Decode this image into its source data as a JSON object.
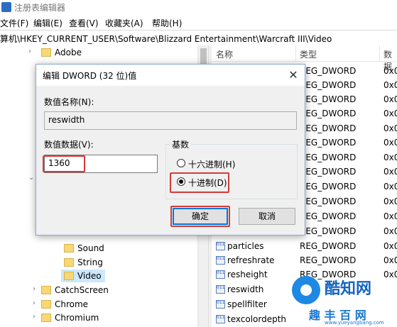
{
  "window": {
    "title": "注册表编辑器"
  },
  "menu": [
    "文件(F)",
    "编辑(E)",
    "查看(V)",
    "收藏夹(A)",
    "帮助(H)"
  ],
  "address": "计算机\\HKEY_CURRENT_USER\\Software\\Blizzard Entertainment\\Warcraft III\\Video",
  "tree": {
    "top_items": [
      "Adobe"
    ],
    "video_children": [
      "Sound",
      "String",
      "Video"
    ],
    "bottom_items": [
      "CatchScreen",
      "Chrome",
      "Chromium"
    ]
  },
  "list": {
    "headers": {
      "name": "名称",
      "type": "类型",
      "data": "数据"
    },
    "upper_types": [
      "REG_DWORD",
      "REG_DWORD",
      "REG_DWORD",
      "REG_DWORD",
      "REG_DWORD",
      "REG_DWORD",
      "REG_DWORD",
      "REG_DWORD",
      "REG_DWORD",
      "REG_DWORD",
      "REG_DWORD",
      "REG_DWORD"
    ],
    "upper_data": [
      "0x0",
      "0x0",
      "0x0",
      "0x0",
      "0x0",
      "0x0",
      "0x0",
      "0x0",
      "0x0",
      "0x0",
      "0x0",
      "0x0"
    ],
    "rows": [
      {
        "name": "particles",
        "type": "REG_DWORD",
        "data": "0x0"
      },
      {
        "name": "refreshrate",
        "type": "REG_DWORD",
        "data": "0x0"
      },
      {
        "name": "resheight",
        "type": "REG_DWORD",
        "data": "0x0"
      },
      {
        "name": "reswidth",
        "type": "",
        "data": ""
      },
      {
        "name": "spellfilter",
        "type": "",
        "data": ""
      },
      {
        "name": "texcolordepth",
        "type": "",
        "data": ""
      }
    ]
  },
  "dialog": {
    "title": "编辑 DWORD (32 位)值",
    "close": "✕",
    "name_label": "数值名称(N):",
    "name_value": "reswidth",
    "data_label": "数值数据(V):",
    "data_value": "1360",
    "base_label": "基数",
    "radio_hex": "十六进制(H)",
    "radio_dec": "十进制(D)",
    "ok": "确定",
    "cancel": "取消"
  },
  "watermark": {
    "brand": "酷知网",
    "sub": "趣 丰 百 网",
    "url": "www.yueyangbang.com"
  }
}
